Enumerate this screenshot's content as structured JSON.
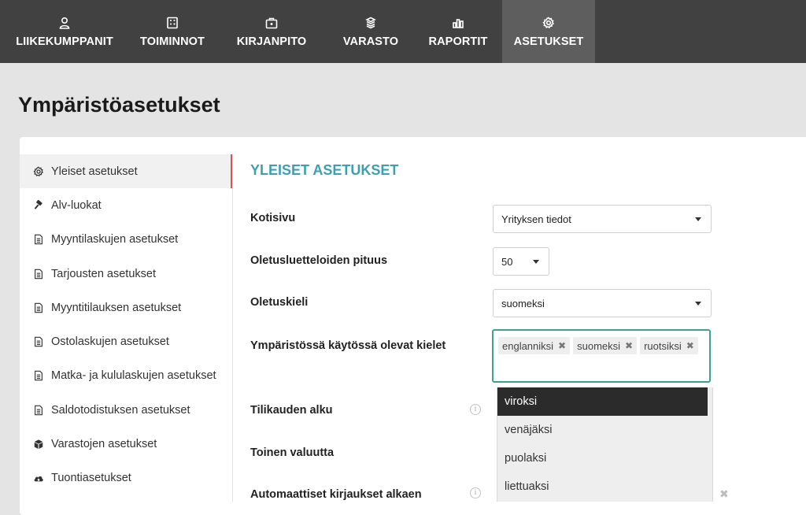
{
  "nav": {
    "items": [
      {
        "label": "LIIKEKUMPPANIT",
        "icon": "person-icon"
      },
      {
        "label": "TOIMINNOT",
        "icon": "calculator-icon"
      },
      {
        "label": "KIRJANPITO",
        "icon": "briefcase-icon"
      },
      {
        "label": "VARASTO",
        "icon": "boxes-icon"
      },
      {
        "label": "RAPORTIT",
        "icon": "bar-chart-icon"
      },
      {
        "label": "ASETUKSET",
        "icon": "gear-icon"
      }
    ],
    "active": "ASETUKSET",
    "bg_color": "#414141",
    "active_color": "#5e5e5e"
  },
  "page": {
    "title": "Ympäristöasetukset"
  },
  "sidebar": {
    "items": [
      {
        "label": "Yleiset asetukset",
        "icon": "gear-icon"
      },
      {
        "label": "Alv-luokat",
        "icon": "gavel-icon"
      },
      {
        "label": "Myyntilaskujen asetukset",
        "icon": "document-icon"
      },
      {
        "label": "Tarjousten asetukset",
        "icon": "document-icon"
      },
      {
        "label": "Myyntitilauksen asetukset",
        "icon": "document-icon"
      },
      {
        "label": "Ostolaskujen asetukset",
        "icon": "document-icon"
      },
      {
        "label": "Matka- ja kululaskujen asetukset",
        "icon": "document-icon"
      },
      {
        "label": "Saldotodistuksen asetukset",
        "icon": "document-icon"
      },
      {
        "label": "Varastojen asetukset",
        "icon": "cube-icon"
      },
      {
        "label": "Tuontiasetukset",
        "icon": "cloud-upload-icon"
      }
    ],
    "active_index": 0
  },
  "main": {
    "section_title": "YLEISET ASETUKSET",
    "accent_color": "#3c9fb3",
    "fields": {
      "kotisivu": {
        "label": "Kotisivu",
        "value": "Yrityksen tiedot"
      },
      "list_length": {
        "label": "Oletusluetteloiden pituus",
        "value": "50"
      },
      "default_language": {
        "label": "Oletuskieli",
        "value": "suomeksi"
      },
      "languages": {
        "label": "Ympäristössä käytössä olevat kielet",
        "tags": [
          "englanniksi",
          "suomeksi",
          "ruotsiksi"
        ]
      },
      "fiscal_start": {
        "label": "Tilikauden alku"
      },
      "second_currency": {
        "label": "Toinen valuutta"
      },
      "auto_entries": {
        "label": "Automaattiset kirjaukset alkaen"
      }
    },
    "dropdown_options": [
      "viroksi",
      "venäjäksi",
      "puolaksi",
      "liettuaksi"
    ],
    "dropdown_highlighted": "viroksi",
    "info_glyph": "i",
    "clear_glyph": "✖"
  }
}
